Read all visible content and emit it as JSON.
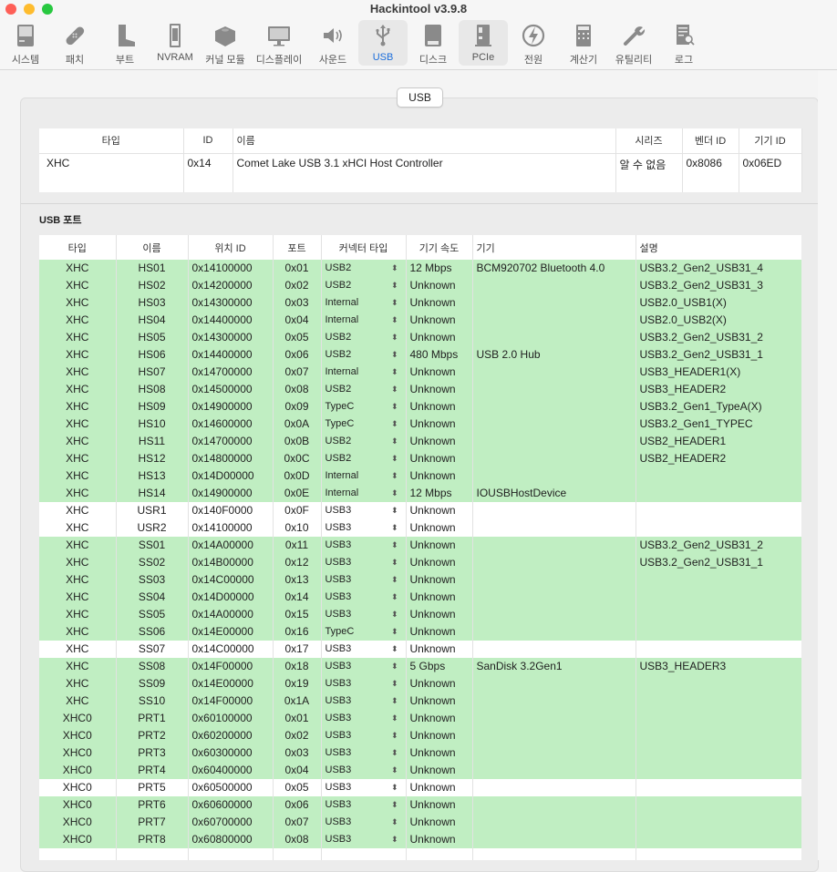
{
  "window": {
    "title": "Hackintool v3.9.8",
    "traffic_lights": {
      "close": "#fe5f57",
      "minimize": "#febc2e",
      "maximize": "#28c840"
    }
  },
  "toolbar": {
    "items": [
      {
        "label": "시스템",
        "icon": "computer-icon"
      },
      {
        "label": "패치",
        "icon": "bandage-icon"
      },
      {
        "label": "부트",
        "icon": "boot-icon"
      },
      {
        "label": "NVRAM",
        "icon": "memory-chip-icon"
      },
      {
        "label": "커널 모듈",
        "icon": "lego-brick-icon"
      },
      {
        "label": "디스플레이",
        "icon": "monitor-icon"
      },
      {
        "label": "사운드",
        "icon": "speaker-icon"
      },
      {
        "label": "USB",
        "icon": "usb-icon",
        "active": true
      },
      {
        "label": "디스크",
        "icon": "disk-icon"
      },
      {
        "label": "PCIe",
        "icon": "pcie-card-icon"
      },
      {
        "label": "전원",
        "icon": "power-bolt-icon"
      },
      {
        "label": "계산기",
        "icon": "calculator-icon"
      },
      {
        "label": "유틸리티",
        "icon": "wrench-icon"
      },
      {
        "label": "로그",
        "icon": "log-search-icon"
      }
    ],
    "active_color": "#1a6ddb"
  },
  "panel": {
    "tab_label": "USB"
  },
  "controllers": {
    "headers": [
      "타입",
      "ID",
      "이름",
      "시리즈",
      "벤더 ID",
      "기기 ID"
    ],
    "rows": [
      [
        "XHC",
        "0x14",
        "Comet Lake USB 3.1 xHCI Host Controller",
        "알 수 없음",
        "0x8086",
        "0x06ED"
      ]
    ]
  },
  "ports": {
    "section_label": "USB 포트",
    "headers": [
      "타입",
      "이름",
      "위치 ID",
      "포트",
      "커넥터 타입",
      "기기 속도",
      "기기",
      "설명"
    ],
    "active_color": "#c0eec2",
    "rows": [
      {
        "type": "XHC",
        "name": "HS01",
        "location": "0x14100000",
        "port": "0x01",
        "connector": "USB2",
        "speed": "12 Mbps",
        "device": "BCM920702 Bluetooth 4.0",
        "comment": "USB3.2_Gen2_USB31_4",
        "active": true
      },
      {
        "type": "XHC",
        "name": "HS02",
        "location": "0x14200000",
        "port": "0x02",
        "connector": "USB2",
        "speed": "Unknown",
        "device": "",
        "comment": "USB3.2_Gen2_USB31_3",
        "active": true
      },
      {
        "type": "XHC",
        "name": "HS03",
        "location": "0x14300000",
        "port": "0x03",
        "connector": "Internal",
        "speed": "Unknown",
        "device": "",
        "comment": "USB2.0_USB1(X)",
        "active": true
      },
      {
        "type": "XHC",
        "name": "HS04",
        "location": "0x14400000",
        "port": "0x04",
        "connector": "Internal",
        "speed": "Unknown",
        "device": "",
        "comment": "USB2.0_USB2(X)",
        "active": true
      },
      {
        "type": "XHC",
        "name": "HS05",
        "location": "0x14300000",
        "port": "0x05",
        "connector": "USB2",
        "speed": "Unknown",
        "device": "",
        "comment": "USB3.2_Gen2_USB31_2",
        "active": true
      },
      {
        "type": "XHC",
        "name": "HS06",
        "location": "0x14400000",
        "port": "0x06",
        "connector": "USB2",
        "speed": "480 Mbps",
        "device": "USB 2.0 Hub",
        "comment": "USB3.2_Gen2_USB31_1",
        "active": true
      },
      {
        "type": "XHC",
        "name": "HS07",
        "location": "0x14700000",
        "port": "0x07",
        "connector": "Internal",
        "speed": "Unknown",
        "device": "",
        "comment": "USB3_HEADER1(X)",
        "active": true
      },
      {
        "type": "XHC",
        "name": "HS08",
        "location": "0x14500000",
        "port": "0x08",
        "connector": "USB2",
        "speed": "Unknown",
        "device": "",
        "comment": "USB3_HEADER2",
        "active": true
      },
      {
        "type": "XHC",
        "name": "HS09",
        "location": "0x14900000",
        "port": "0x09",
        "connector": "TypeC",
        "speed": "Unknown",
        "device": "",
        "comment": "USB3.2_Gen1_TypeA(X)",
        "active": true
      },
      {
        "type": "XHC",
        "name": "HS10",
        "location": "0x14600000",
        "port": "0x0A",
        "connector": "TypeC",
        "speed": "Unknown",
        "device": "",
        "comment": "USB3.2_Gen1_TYPEC",
        "active": true
      },
      {
        "type": "XHC",
        "name": "HS11",
        "location": "0x14700000",
        "port": "0x0B",
        "connector": "USB2",
        "speed": "Unknown",
        "device": "",
        "comment": "USB2_HEADER1",
        "active": true
      },
      {
        "type": "XHC",
        "name": "HS12",
        "location": "0x14800000",
        "port": "0x0C",
        "connector": "USB2",
        "speed": "Unknown",
        "device": "",
        "comment": "USB2_HEADER2",
        "active": true
      },
      {
        "type": "XHC",
        "name": "HS13",
        "location": "0x14D00000",
        "port": "0x0D",
        "connector": "Internal",
        "speed": "Unknown",
        "device": "",
        "comment": "",
        "active": true
      },
      {
        "type": "XHC",
        "name": "HS14",
        "location": "0x14900000",
        "port": "0x0E",
        "connector": "Internal",
        "speed": "12 Mbps",
        "device": "IOUSBHostDevice",
        "comment": "",
        "active": true
      },
      {
        "type": "XHC",
        "name": "USR1",
        "location": "0x140F0000",
        "port": "0x0F",
        "connector": "USB3",
        "speed": "Unknown",
        "device": "",
        "comment": "",
        "active": false
      },
      {
        "type": "XHC",
        "name": "USR2",
        "location": "0x14100000",
        "port": "0x10",
        "connector": "USB3",
        "speed": "Unknown",
        "device": "",
        "comment": "",
        "active": false
      },
      {
        "type": "XHC",
        "name": "SS01",
        "location": "0x14A00000",
        "port": "0x11",
        "connector": "USB3",
        "speed": "Unknown",
        "device": "",
        "comment": "USB3.2_Gen2_USB31_2",
        "active": true
      },
      {
        "type": "XHC",
        "name": "SS02",
        "location": "0x14B00000",
        "port": "0x12",
        "connector": "USB3",
        "speed": "Unknown",
        "device": "",
        "comment": "USB3.2_Gen2_USB31_1",
        "active": true
      },
      {
        "type": "XHC",
        "name": "SS03",
        "location": "0x14C00000",
        "port": "0x13",
        "connector": "USB3",
        "speed": "Unknown",
        "device": "",
        "comment": "",
        "active": true
      },
      {
        "type": "XHC",
        "name": "SS04",
        "location": "0x14D00000",
        "port": "0x14",
        "connector": "USB3",
        "speed": "Unknown",
        "device": "",
        "comment": "",
        "active": true
      },
      {
        "type": "XHC",
        "name": "SS05",
        "location": "0x14A00000",
        "port": "0x15",
        "connector": "USB3",
        "speed": "Unknown",
        "device": "",
        "comment": "",
        "active": true
      },
      {
        "type": "XHC",
        "name": "SS06",
        "location": "0x14E00000",
        "port": "0x16",
        "connector": "TypeC",
        "speed": "Unknown",
        "device": "",
        "comment": "",
        "active": true
      },
      {
        "type": "XHC",
        "name": "SS07",
        "location": "0x14C00000",
        "port": "0x17",
        "connector": "USB3",
        "speed": "Unknown",
        "device": "",
        "comment": "",
        "active": false
      },
      {
        "type": "XHC",
        "name": "SS08",
        "location": "0x14F00000",
        "port": "0x18",
        "connector": "USB3",
        "speed": "5 Gbps",
        "device": "SanDisk 3.2Gen1",
        "comment": "USB3_HEADER3",
        "active": true
      },
      {
        "type": "XHC",
        "name": "SS09",
        "location": "0x14E00000",
        "port": "0x19",
        "connector": "USB3",
        "speed": "Unknown",
        "device": "",
        "comment": "",
        "active": true
      },
      {
        "type": "XHC",
        "name": "SS10",
        "location": "0x14F00000",
        "port": "0x1A",
        "connector": "USB3",
        "speed": "Unknown",
        "device": "",
        "comment": "",
        "active": true
      },
      {
        "type": "XHC0",
        "name": "PRT1",
        "location": "0x60100000",
        "port": "0x01",
        "connector": "USB3",
        "speed": "Unknown",
        "device": "",
        "comment": "",
        "active": true
      },
      {
        "type": "XHC0",
        "name": "PRT2",
        "location": "0x60200000",
        "port": "0x02",
        "connector": "USB3",
        "speed": "Unknown",
        "device": "",
        "comment": "",
        "active": true
      },
      {
        "type": "XHC0",
        "name": "PRT3",
        "location": "0x60300000",
        "port": "0x03",
        "connector": "USB3",
        "speed": "Unknown",
        "device": "",
        "comment": "",
        "active": true
      },
      {
        "type": "XHC0",
        "name": "PRT4",
        "location": "0x60400000",
        "port": "0x04",
        "connector": "USB3",
        "speed": "Unknown",
        "device": "",
        "comment": "",
        "active": true
      },
      {
        "type": "XHC0",
        "name": "PRT5",
        "location": "0x60500000",
        "port": "0x05",
        "connector": "USB3",
        "speed": "Unknown",
        "device": "",
        "comment": "",
        "active": false
      },
      {
        "type": "XHC0",
        "name": "PRT6",
        "location": "0x60600000",
        "port": "0x06",
        "connector": "USB3",
        "speed": "Unknown",
        "device": "",
        "comment": "",
        "active": true
      },
      {
        "type": "XHC0",
        "name": "PRT7",
        "location": "0x60700000",
        "port": "0x07",
        "connector": "USB3",
        "speed": "Unknown",
        "device": "",
        "comment": "",
        "active": true
      },
      {
        "type": "XHC0",
        "name": "PRT8",
        "location": "0x60800000",
        "port": "0x08",
        "connector": "USB3",
        "speed": "Unknown",
        "device": "",
        "comment": "",
        "active": true
      }
    ]
  }
}
